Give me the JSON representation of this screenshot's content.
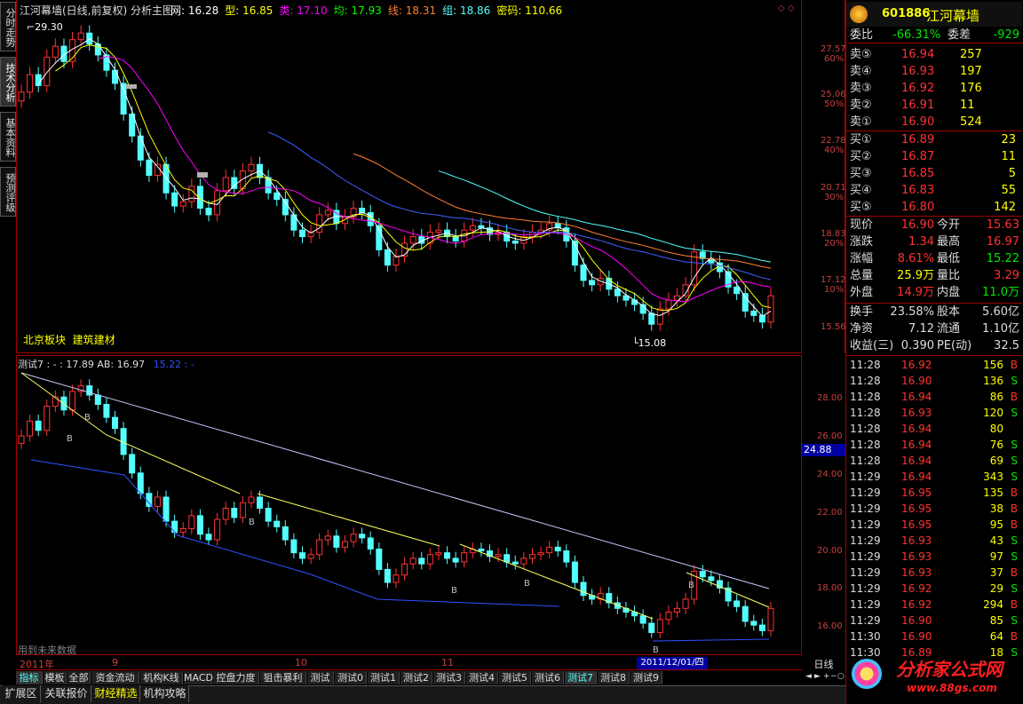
{
  "header": {
    "title": "江河幕墙(日线,前复权) 分析主图",
    "indicators": [
      {
        "label": "网: 16.28",
        "color": "#ffffff"
      },
      {
        "label": "型: 16.85",
        "color": "#ffff00"
      },
      {
        "label": "类: 17.10",
        "color": "#ff00ff"
      },
      {
        "label": "均: 17.93",
        "color": "#00ff00"
      },
      {
        "label": "线: 18.31",
        "color": "#ff8030"
      },
      {
        "label": "组: 18.86",
        "color": "#54ffff"
      },
      {
        "label": "密码: 110.66",
        "color": "#ffff00"
      }
    ]
  },
  "left_tabs": [
    "分时走势",
    "技术分析",
    "基本资料",
    "预测评级"
  ],
  "main_chart": {
    "high_label": "29.30",
    "low_label": "15.08",
    "sector_text": "北京板块  建筑建材",
    "y_ticks": [
      {
        "price": "27.57",
        "pct": "60%"
      },
      {
        "price": "25.06",
        "pct": "50%"
      },
      {
        "price": "22.78",
        "pct": "40%"
      },
      {
        "price": "20.71",
        "pct": "30%"
      },
      {
        "price": "18.83",
        "pct": "20%"
      },
      {
        "price": "17.12",
        "pct": "10%"
      },
      {
        "price": "15.56",
        "pct": ""
      }
    ]
  },
  "sub_chart": {
    "title": "测试7 : - : 17.89  AB: 16.97",
    "blue_value": "15.22 : -",
    "price_marker": "24.88",
    "no_data_text": "用到未来数据",
    "b_labels": [
      "B",
      "B",
      "B",
      "B",
      "B",
      "B",
      "B"
    ],
    "y_ticks": [
      "28.00",
      "26.00",
      "24.00",
      "22.00",
      "20.00",
      "18.00",
      "16.00"
    ]
  },
  "date_axis": {
    "labels": [
      "2011年",
      "9",
      "10",
      "11"
    ],
    "current_date": "2011/12/01/四",
    "period": "日线"
  },
  "indicator_tabs": [
    "指标",
    "模板",
    "全部",
    "资金流动",
    "机构K线",
    "MACD",
    "控盘力度",
    "狙击暴利",
    "测试",
    "测试0",
    "测试1",
    "测试2",
    "测试3",
    "测试4",
    "测试5",
    "测试6",
    "测试7",
    "测试8",
    "测试9"
  ],
  "scroll_buttons": [
    "◄",
    "►",
    "+",
    "−",
    "○"
  ],
  "bottom_tabs": [
    "扩展区",
    "关联报价",
    "财经精选",
    "机构攻略"
  ],
  "stock": {
    "code": "601886",
    "name": "江河幕墙"
  },
  "quote": {
    "weibi": {
      "label": "委比",
      "value": "-66.31%",
      "diff_label": "委差",
      "diff": "-929"
    },
    "sells": [
      {
        "label": "卖⑤",
        "price": "16.94",
        "vol": "257"
      },
      {
        "label": "卖④",
        "price": "16.93",
        "vol": "197"
      },
      {
        "label": "卖③",
        "price": "16.92",
        "vol": "176"
      },
      {
        "label": "卖②",
        "price": "16.91",
        "vol": "11"
      },
      {
        "label": "卖①",
        "price": "16.90",
        "vol": "524"
      }
    ],
    "buys": [
      {
        "label": "买①",
        "price": "16.89",
        "vol": "23"
      },
      {
        "label": "买②",
        "price": "16.87",
        "vol": "11"
      },
      {
        "label": "买③",
        "price": "16.85",
        "vol": "5"
      },
      {
        "label": "买④",
        "price": "16.83",
        "vol": "55"
      },
      {
        "label": "买⑤",
        "price": "16.80",
        "vol": "142"
      }
    ],
    "stats": [
      {
        "l1": "现价",
        "v1": "16.90",
        "c1": "#ff3232",
        "l2": "今开",
        "v2": "15.63",
        "c2": "#ff3232"
      },
      {
        "l1": "涨跌",
        "v1": "1.34",
        "c1": "#ff3232",
        "l2": "最高",
        "v2": "16.97",
        "c2": "#ff3232"
      },
      {
        "l1": "涨幅",
        "v1": "8.61%",
        "c1": "#ff3232",
        "l2": "最低",
        "v2": "15.22",
        "c2": "#00e600"
      },
      {
        "l1": "总量",
        "v1": "25.9万",
        "c1": "#ffff00",
        "l2": "量比",
        "v2": "3.29",
        "c2": "#ff3232"
      },
      {
        "l1": "外盘",
        "v1": "14.9万",
        "c1": "#ff3232",
        "l2": "内盘",
        "v2": "11.0万",
        "c2": "#00e600"
      }
    ],
    "stats2": [
      {
        "l1": "换手",
        "v1": "23.58%",
        "l2": "股本",
        "v2": "5.60亿"
      },
      {
        "l1": "净资",
        "v1": "7.12",
        "l2": "流通",
        "v2": "1.10亿"
      },
      {
        "l1": "收益(三)",
        "v1": "0.390",
        "l2": "PE(动)",
        "v2": "32.5"
      }
    ]
  },
  "ticks": [
    {
      "t": "11:28",
      "p": "16.92",
      "v": "156",
      "s": "B"
    },
    {
      "t": "11:28",
      "p": "16.90",
      "v": "136",
      "s": "S"
    },
    {
      "t": "11:28",
      "p": "16.94",
      "v": "86",
      "s": "B"
    },
    {
      "t": "11:28",
      "p": "16.93",
      "v": "120",
      "s": "S"
    },
    {
      "t": "11:28",
      "p": "16.94",
      "v": "80",
      "s": ""
    },
    {
      "t": "11:28",
      "p": "16.94",
      "v": "76",
      "s": "S"
    },
    {
      "t": "11:28",
      "p": "16.94",
      "v": "69",
      "s": "S"
    },
    {
      "t": "11:29",
      "p": "16.94",
      "v": "343",
      "s": "S"
    },
    {
      "t": "11:29",
      "p": "16.95",
      "v": "135",
      "s": "B"
    },
    {
      "t": "11:29",
      "p": "16.95",
      "v": "38",
      "s": "B"
    },
    {
      "t": "11:29",
      "p": "16.95",
      "v": "95",
      "s": "B"
    },
    {
      "t": "11:29",
      "p": "16.93",
      "v": "43",
      "s": "S"
    },
    {
      "t": "11:29",
      "p": "16.93",
      "v": "97",
      "s": "S"
    },
    {
      "t": "11:29",
      "p": "16.93",
      "v": "37",
      "s": "B"
    },
    {
      "t": "11:29",
      "p": "16.92",
      "v": "29",
      "s": "S"
    },
    {
      "t": "11:29",
      "p": "16.92",
      "v": "294",
      "s": "B"
    },
    {
      "t": "11:29",
      "p": "16.90",
      "v": "85",
      "s": "S"
    },
    {
      "t": "11:30",
      "p": "16.90",
      "v": "64",
      "s": "B"
    },
    {
      "t": "11:30",
      "p": "16.89",
      "v": "18",
      "s": "S"
    }
  ],
  "watermark": {
    "name": "分析家公式网",
    "url": "www.88gs.com"
  },
  "colors": {
    "up": "#ff3232",
    "down": "#54ffff",
    "border": "#a00000"
  }
}
